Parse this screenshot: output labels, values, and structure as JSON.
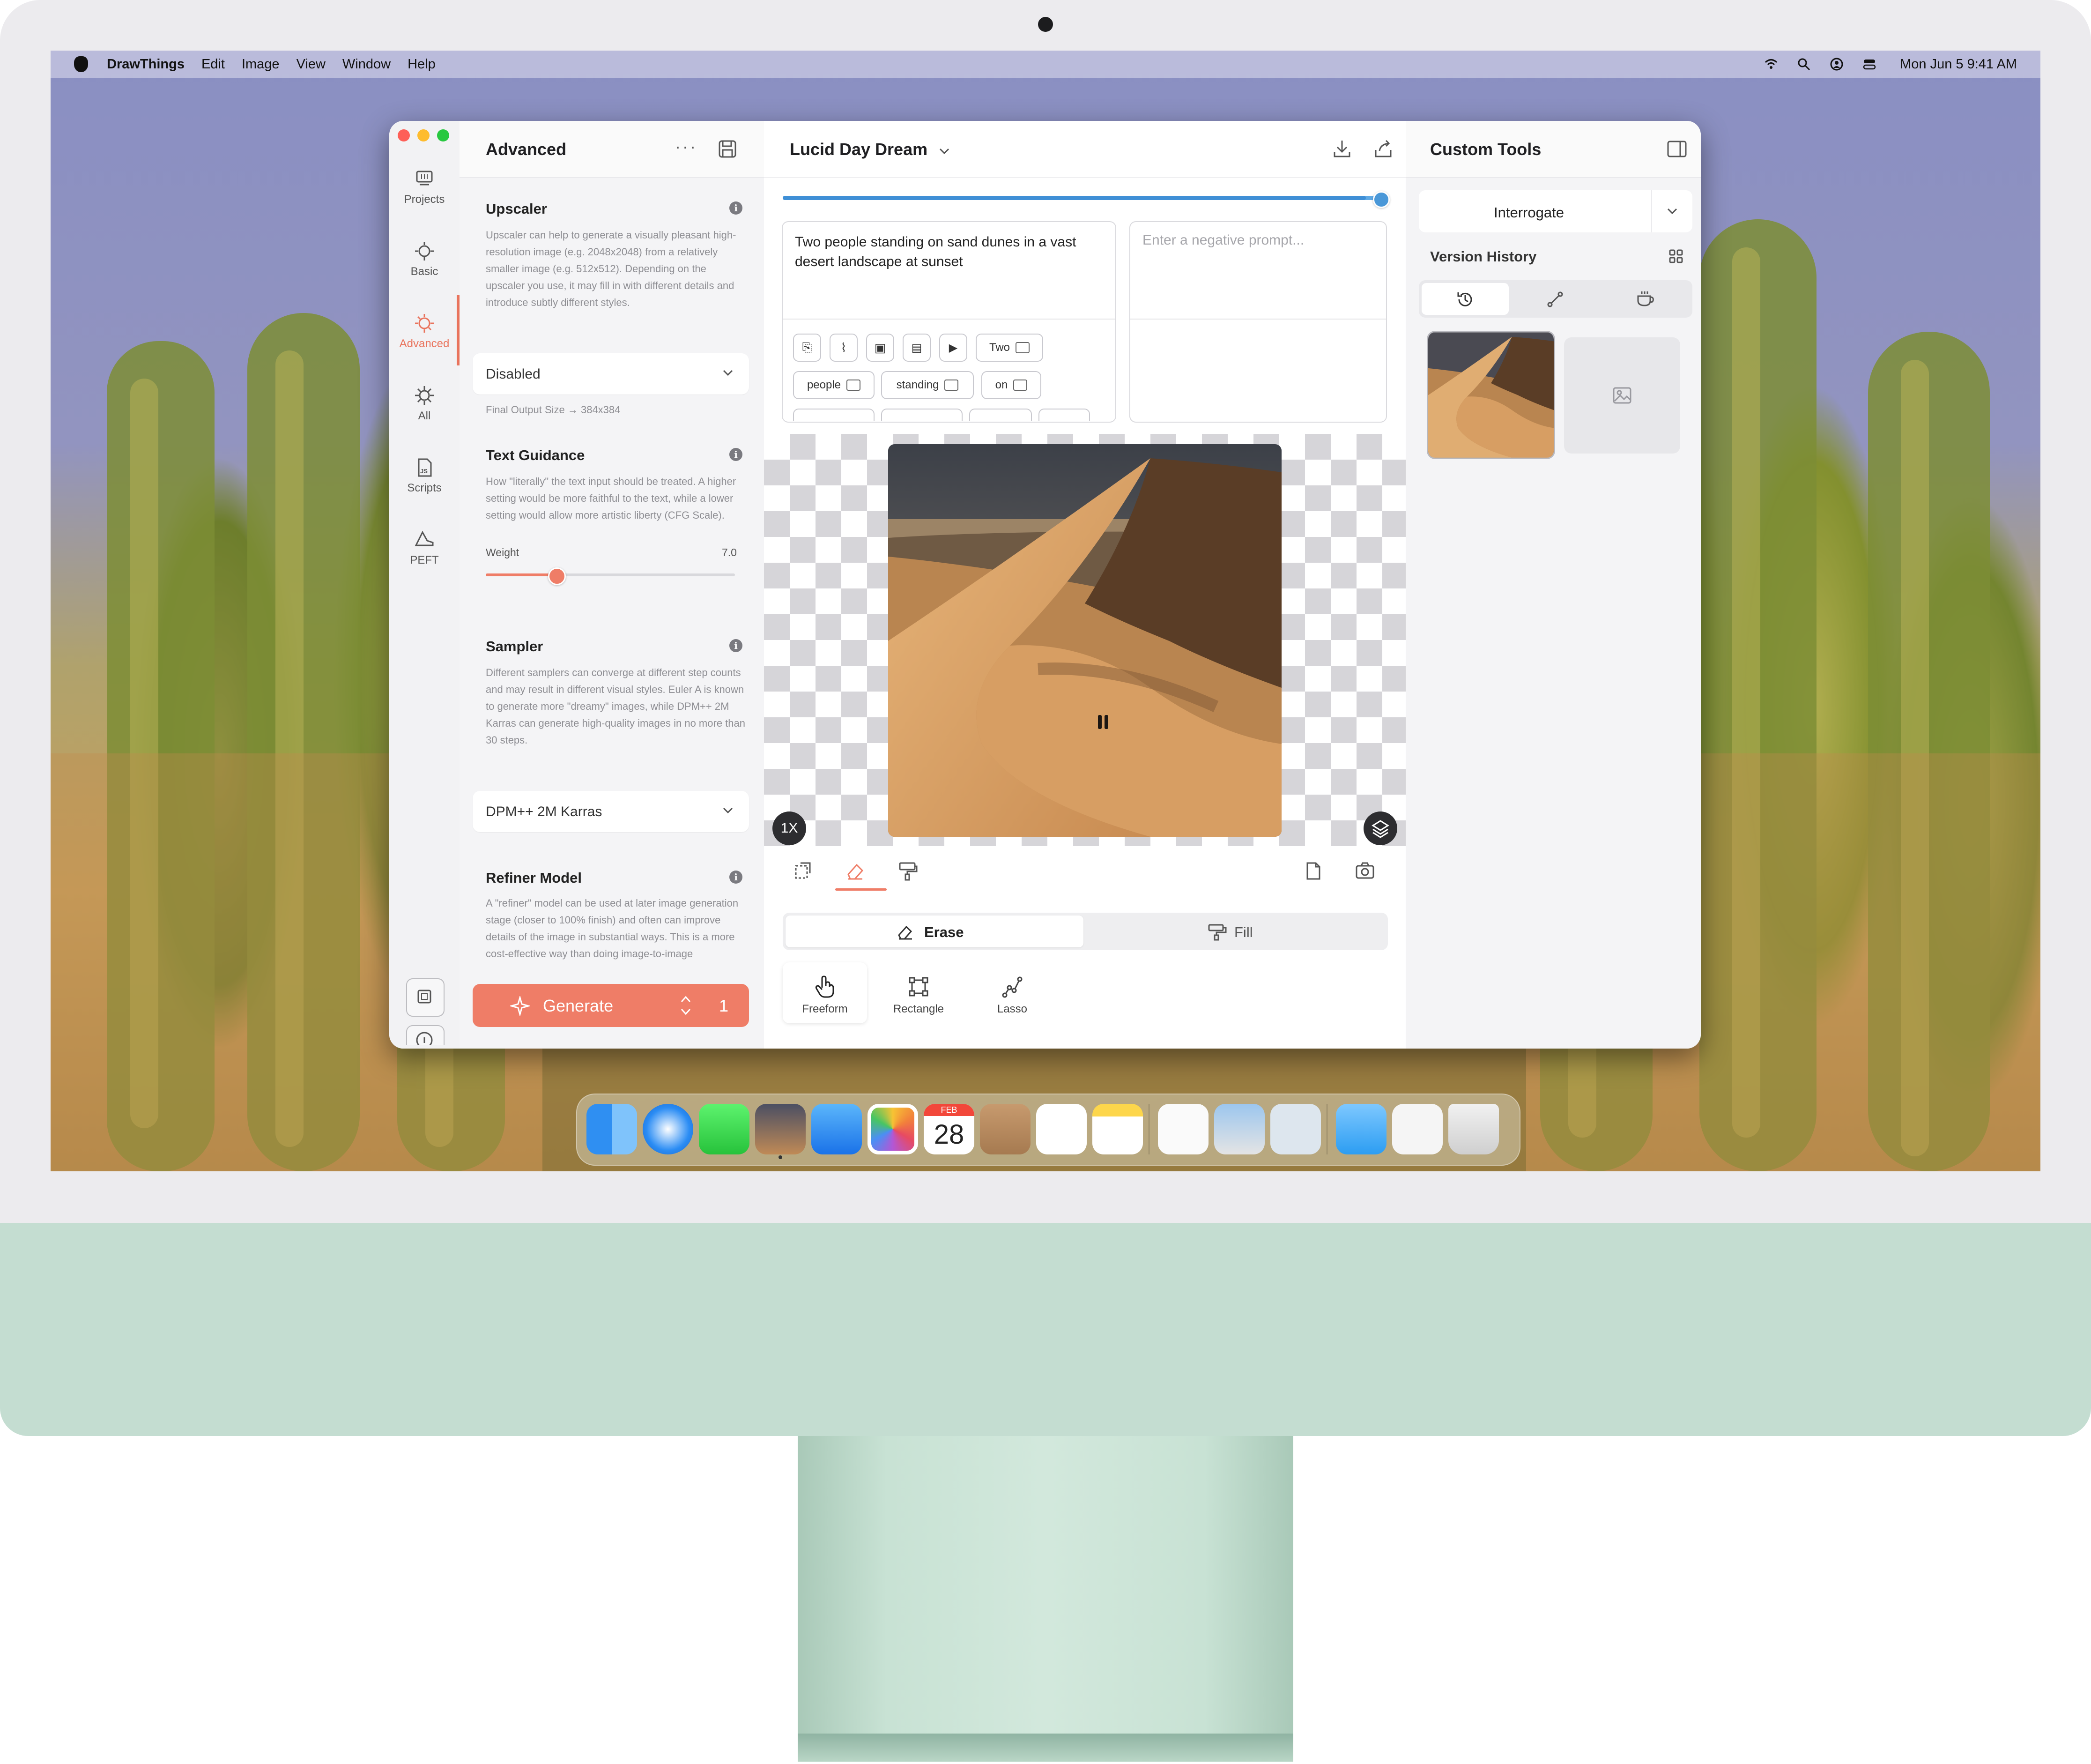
{
  "menubar": {
    "app_name": "DrawThings",
    "menus": [
      "Edit",
      "Image",
      "View",
      "Window",
      "Help"
    ],
    "clock": "Mon Jun 5  9:41 AM",
    "icons": [
      "wifi-icon",
      "search-icon",
      "user-icon",
      "control-center-icon"
    ]
  },
  "rail": {
    "items": [
      {
        "label": "Projects",
        "icon": "projects-icon"
      },
      {
        "label": "Basic",
        "icon": "basic-settings-icon"
      },
      {
        "label": "Advanced",
        "icon": "advanced-settings-icon",
        "active": true
      },
      {
        "label": "All",
        "icon": "all-settings-icon"
      },
      {
        "label": "Scripts",
        "icon": "scripts-icon"
      },
      {
        "label": "PEFT",
        "icon": "peft-icon"
      }
    ]
  },
  "advanced": {
    "title": "Advanced",
    "upscaler": {
      "title": "Upscaler",
      "description": "Upscaler can help to generate a visually pleasant high-resolution image (e.g. 2048x2048) from a relatively smaller image (e.g. 512x512). Depending on the upscaler you use, it may fill in with different details and introduce subtly different styles.",
      "selected": "Disabled",
      "final_output": "Final Output Size → 384x384"
    },
    "text_guidance": {
      "title": "Text Guidance",
      "description": "How \"literally\" the text input should be treated. A higher setting would be more faithful to the text, while a lower setting would allow more artistic liberty (CFG Scale).",
      "weight_label": "Weight",
      "weight_value": "7.0",
      "slider_fraction": 0.28
    },
    "sampler": {
      "title": "Sampler",
      "description": "Different samplers can converge at different step counts and may result in different visual styles. Euler A is known to generate more \"dreamy\" images, while DPM++ 2M Karras can generate high-quality images in no more than 30 steps.",
      "selected": "DPM++ 2M Karras"
    },
    "refiner": {
      "title": "Refiner Model",
      "description": "A \"refiner\" model can be used at later image generation stage (closer to 100% finish) and often can improve details of the image in substantial ways. This is a more cost-effective way than doing image-to-image"
    },
    "generate": {
      "label": "Generate",
      "count": "1"
    }
  },
  "center": {
    "project_title": "Lucid Day Dream",
    "progress_fraction": 0.98,
    "prompt": "Two people standing on sand dunes in a vast desert landscape at sunset",
    "negative_placeholder": "Enter a negative prompt...",
    "chips": [
      "Two",
      "people",
      "standing",
      "on"
    ],
    "zoom": "1X",
    "modes": {
      "erase": "Erase",
      "fill": "Fill"
    },
    "brushes": [
      "Freeform",
      "Rectangle",
      "Lasso"
    ]
  },
  "right": {
    "title": "Custom Tools",
    "interrogate": "Interrogate",
    "version_history": "Version History"
  },
  "dock": {
    "icons": [
      "finder-icon",
      "safari-icon",
      "messages-icon",
      "drawthings-icon",
      "mail-icon",
      "photos-icon",
      "calendar-icon",
      "contacts-icon",
      "reminders-icon",
      "notes-icon",
      "textedit-icon",
      "preview-icon",
      "blank-app-icon",
      "folder-icon",
      "document-icon",
      "trash-icon"
    ],
    "calendar_month": "FEB",
    "calendar_day": "28"
  },
  "colors": {
    "accent": "#ef7d67",
    "progress": "#5fa9e5",
    "imac_chin": "#c4ddd1"
  }
}
